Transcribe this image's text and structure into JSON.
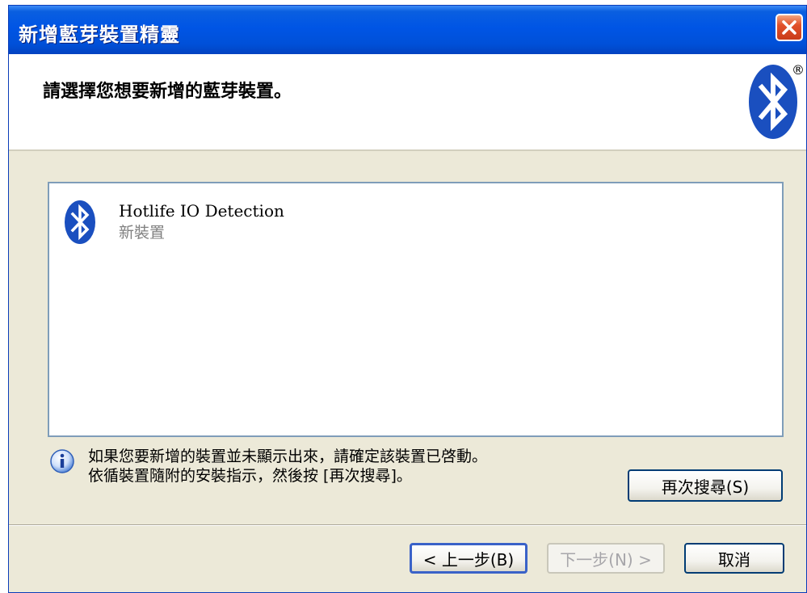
{
  "window": {
    "title": "新增藍芽裝置精靈",
    "close_label": "×"
  },
  "header": {
    "heading": "請選擇您想要新增的藍芽裝置。",
    "logo_mark": "®"
  },
  "devices": [
    {
      "name": "Hotlife IO Detection",
      "status": "新裝置"
    }
  ],
  "info": {
    "line1": "如果您要新增的裝置並未顯示出來，請確定該裝置已啓動。",
    "line2": "依循裝置隨附的安裝指示，然後按 [再次搜尋]。"
  },
  "buttons": {
    "search_again": "再次搜尋(S)",
    "back": "< 上一步(B)",
    "next": "下一步(N) >",
    "cancel": "取消"
  },
  "colors": {
    "titlebar": "#0055e5",
    "dialog_bg": "#ece9d8",
    "bluetooth_blue": "#1a4fbf",
    "list_border": "#7f9db9"
  },
  "icons": {
    "close": "close-icon",
    "logo": "bluetooth-logo-icon",
    "device": "bluetooth-device-icon",
    "info": "info-icon"
  }
}
